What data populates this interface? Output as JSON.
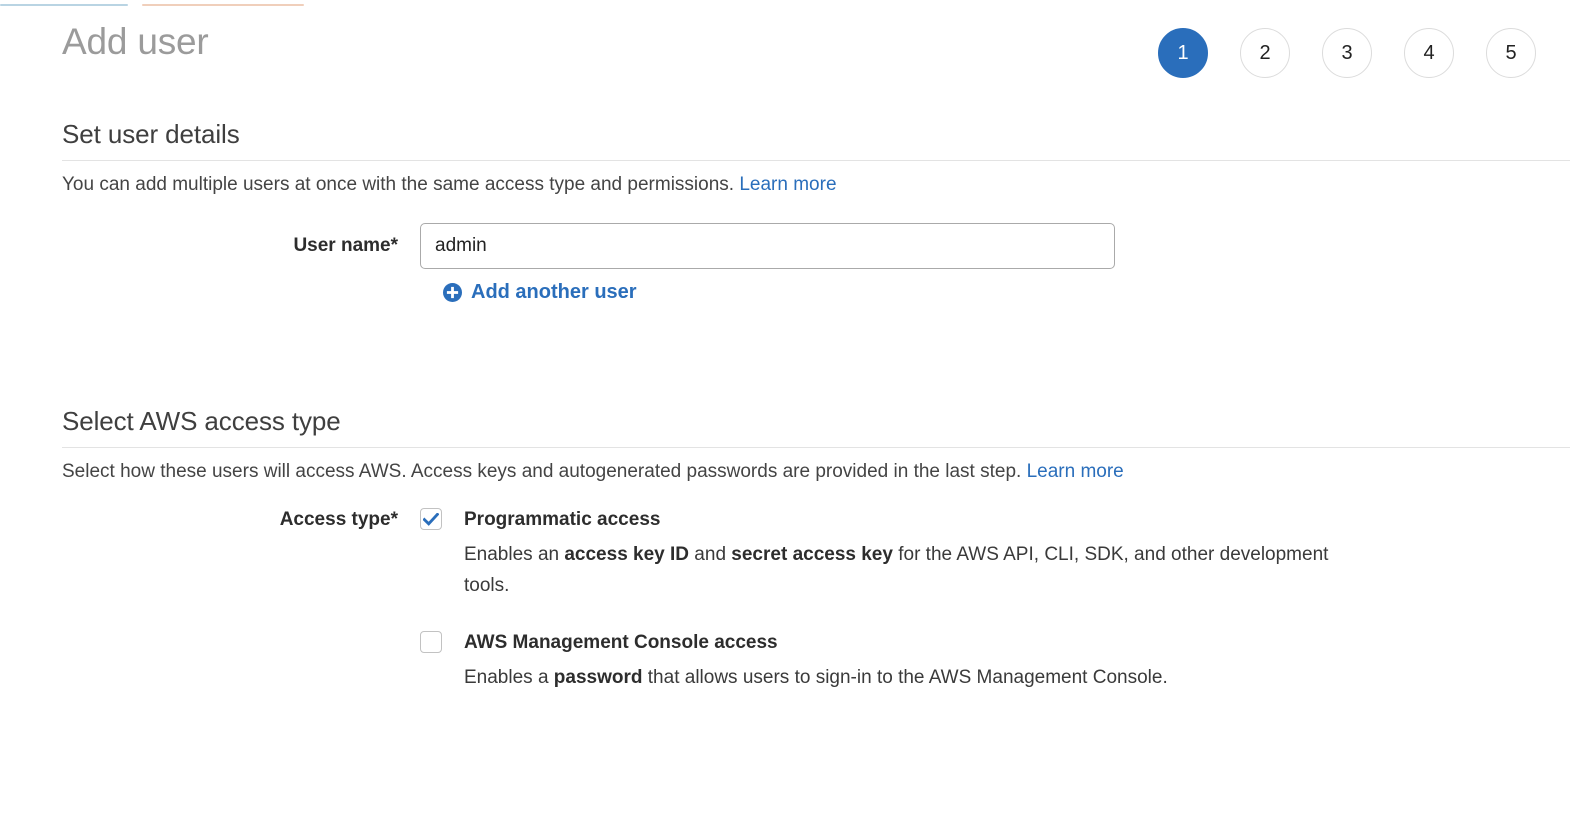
{
  "window": {
    "title": "Add user",
    "tab_strip_colors": [
      "#b9d4e3",
      "#f0cfbb"
    ]
  },
  "theme": {
    "accent_blue": "#2a6ebb",
    "title_gray": "#9b9b9b",
    "body_text": "#3a3a3a",
    "rule_gray": "#e3e3e3",
    "input_border": "#aaaaaa",
    "checkbox_border": "#c2c2c2"
  },
  "header": {
    "title": "Add user"
  },
  "wizard": {
    "steps": [
      {
        "label": "1",
        "active": true
      },
      {
        "label": "2",
        "active": false
      },
      {
        "label": "3",
        "active": false
      },
      {
        "label": "4",
        "active": false
      },
      {
        "label": "5",
        "active": false
      }
    ],
    "current_step": 1,
    "total_steps": 5
  },
  "user_details": {
    "heading": "Set user details",
    "description": "You can add multiple users at once with the same access type and permissions.",
    "learn_more": "Learn more",
    "username_label": "User name*",
    "username_value": "admin",
    "username_placeholder": "",
    "add_another_label": "Add another user",
    "add_another_icon": "plus-circle-icon"
  },
  "access_type": {
    "heading": "Select AWS access type",
    "description": "Select how these users will access AWS. Access keys and autogenerated passwords are provided in the last step.",
    "learn_more": "Learn more",
    "label": "Access type*",
    "options": [
      {
        "title": "Programmatic access",
        "checked": true,
        "description_parts": [
          {
            "text": "Enables an ",
            "bold": false
          },
          {
            "text": "access key ID",
            "bold": true
          },
          {
            "text": " and ",
            "bold": false
          },
          {
            "text": "secret access key",
            "bold": true
          },
          {
            "text": " for the AWS API, CLI, SDK, and other development tools.",
            "bold": false
          }
        ],
        "description_plain": "Enables an access key ID and secret access key for the AWS API, CLI, SDK, and other development tools."
      },
      {
        "title": "AWS Management Console access",
        "checked": false,
        "description_parts": [
          {
            "text": "Enables a ",
            "bold": false
          },
          {
            "text": "password",
            "bold": true
          },
          {
            "text": " that allows users to sign-in to the AWS Management Console.",
            "bold": false
          }
        ],
        "description_plain": "Enables a password that allows users to sign-in to the AWS Management Console."
      }
    ]
  }
}
